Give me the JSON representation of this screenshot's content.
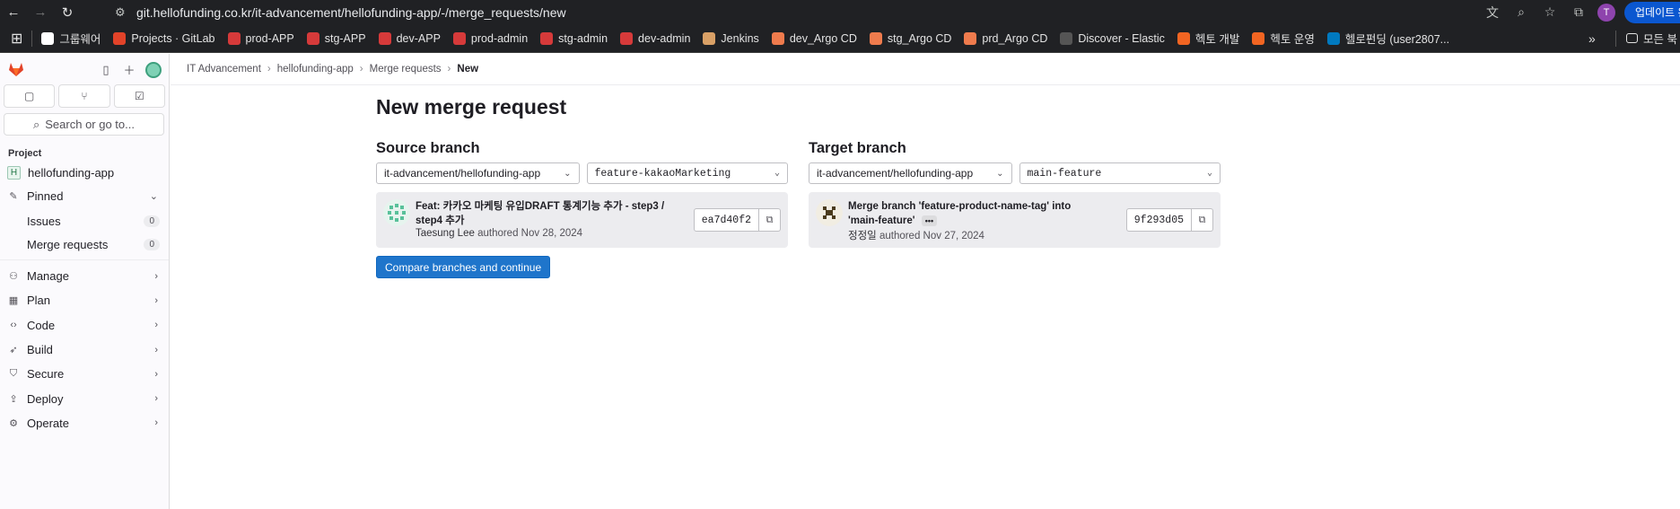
{
  "browser": {
    "url": "git.hellofunding.co.kr/it-advancement/hellofunding-app/-/merge_requests/new",
    "avatar_letter": "T",
    "update_label": "업데이트 완"
  },
  "bookmarks": [
    {
      "label": "그룹웨어",
      "color": "#ffffff"
    },
    {
      "label": "Projects · GitLab",
      "color": "#e24329"
    },
    {
      "label": "prod-APP",
      "color": "#d63a3a"
    },
    {
      "label": "stg-APP",
      "color": "#d63a3a"
    },
    {
      "label": "dev-APP",
      "color": "#d63a3a"
    },
    {
      "label": "prod-admin",
      "color": "#d63a3a"
    },
    {
      "label": "stg-admin",
      "color": "#d63a3a"
    },
    {
      "label": "dev-admin",
      "color": "#d63a3a"
    },
    {
      "label": "Jenkins",
      "color": "#d9a066"
    },
    {
      "label": "dev_Argo CD",
      "color": "#ef7b4d"
    },
    {
      "label": "stg_Argo CD",
      "color": "#ef7b4d"
    },
    {
      "label": "prd_Argo CD",
      "color": "#ef7b4d"
    },
    {
      "label": "Discover - Elastic",
      "color": "#555555"
    },
    {
      "label": "헥토 개발",
      "color": "#f26522"
    },
    {
      "label": "헥토 운영",
      "color": "#f26522"
    },
    {
      "label": "헬로펀딩 (user2807...",
      "color": "#0079bf"
    }
  ],
  "bookmarks_folder": "모든 북",
  "sidebar": {
    "search_label": "Search or go to...",
    "section": "Project",
    "project": {
      "letter": "H",
      "name": "hellofunding-app"
    },
    "pinned_label": "Pinned",
    "pinned_items": [
      {
        "label": "Issues",
        "count": "0"
      },
      {
        "label": "Merge requests",
        "count": "0"
      }
    ],
    "nav_items": [
      {
        "label": "Manage",
        "icon": "users-icon"
      },
      {
        "label": "Plan",
        "icon": "calendar-icon"
      },
      {
        "label": "Code",
        "icon": "code-icon"
      },
      {
        "label": "Build",
        "icon": "rocket-icon"
      },
      {
        "label": "Secure",
        "icon": "shield-icon"
      },
      {
        "label": "Deploy",
        "icon": "deploy-icon"
      },
      {
        "label": "Operate",
        "icon": "operate-icon"
      }
    ]
  },
  "breadcrumb": [
    "IT Advancement",
    "hellofunding-app",
    "Merge requests",
    "New"
  ],
  "page": {
    "title": "New merge request",
    "button_label": "Compare branches and continue"
  },
  "source": {
    "title": "Source branch",
    "project": "it-advancement/hellofunding-app",
    "branch": "feature-kakaoMarketing",
    "commit": {
      "title": "Feat: 카카오 마케팅 유입DRAFT 통계기능 추가 - step3 / step4 추가",
      "author": "Taesung Lee",
      "authored": "authored Nov 28, 2024",
      "sha": "ea7d40f2"
    }
  },
  "target": {
    "title": "Target branch",
    "project": "it-advancement/hellofunding-app",
    "branch": "main-feature",
    "commit": {
      "title": "Merge branch 'feature-product-name-tag' into 'main-feature'",
      "author": "정정일",
      "authored": "authored Nov 27, 2024",
      "sha": "9f293d05"
    }
  }
}
